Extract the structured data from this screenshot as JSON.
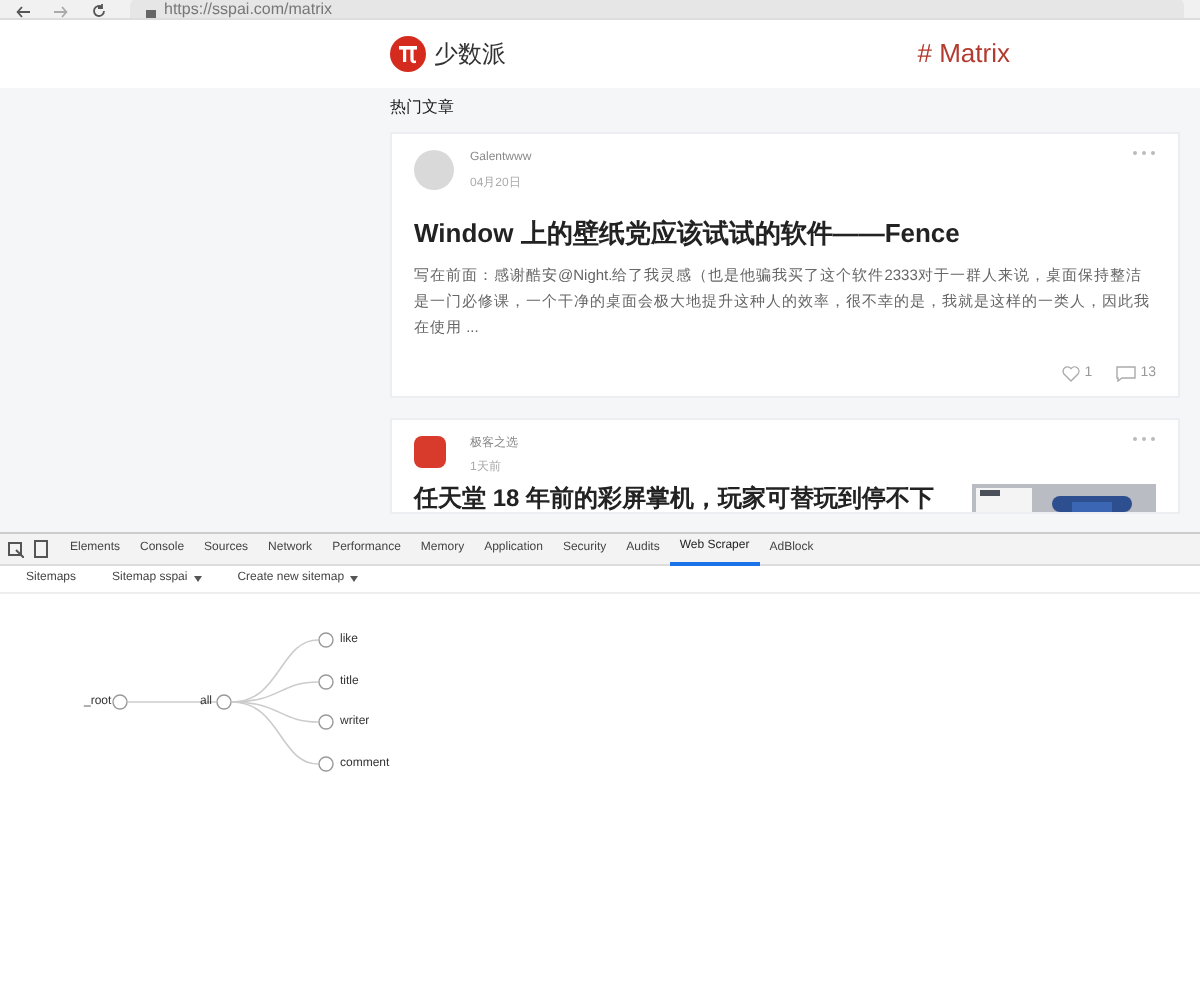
{
  "browser": {
    "url": "https://sspai.com/matrix"
  },
  "header": {
    "logo_text": "少数派",
    "section": "# Matrix"
  },
  "page": {
    "heading": "热门文章",
    "articles": [
      {
        "author": "Galentwww",
        "date": "04月20日",
        "title": "Window 上的壁纸党应该试试的软件——Fence",
        "excerpt": "写在前面：感谢酷安@Night.给了我灵感（也是他骗我买了这个软件2333对于一群人来说，桌面保持整洁是一门必修课，一个干净的桌面会极大地提升这种人的效率，很不幸的是，我就是这样的一类人，因此我在使用 ...",
        "likes": "1",
        "comments": "13"
      },
      {
        "author": "极客之选",
        "date": "1天前",
        "title": "任天堂 18 年前的彩屏掌机，玩家可替玩到停不下",
        "kind": "picture"
      }
    ]
  },
  "devtools": {
    "tabs": [
      {
        "label": "Elements",
        "selected": false
      },
      {
        "label": "Console",
        "selected": false
      },
      {
        "label": "Sources",
        "selected": false
      },
      {
        "label": "Network",
        "selected": false
      },
      {
        "label": "Performance",
        "selected": false
      },
      {
        "label": "Memory",
        "selected": false
      },
      {
        "label": "Application",
        "selected": false
      },
      {
        "label": "Security",
        "selected": false
      },
      {
        "label": "Audits",
        "selected": false
      },
      {
        "label": "Web Scraper",
        "selected": true
      },
      {
        "label": "AdBlock",
        "selected": false
      }
    ],
    "subnav": [
      {
        "label": "Sitemaps",
        "dropdown": false
      },
      {
        "label": "Sitemap sspai",
        "dropdown": true
      },
      {
        "label": "Create new sitemap",
        "dropdown": true
      }
    ],
    "graph": {
      "root": "_root",
      "node": "all",
      "children": [
        "like",
        "title",
        "writer",
        "comment"
      ]
    }
  }
}
